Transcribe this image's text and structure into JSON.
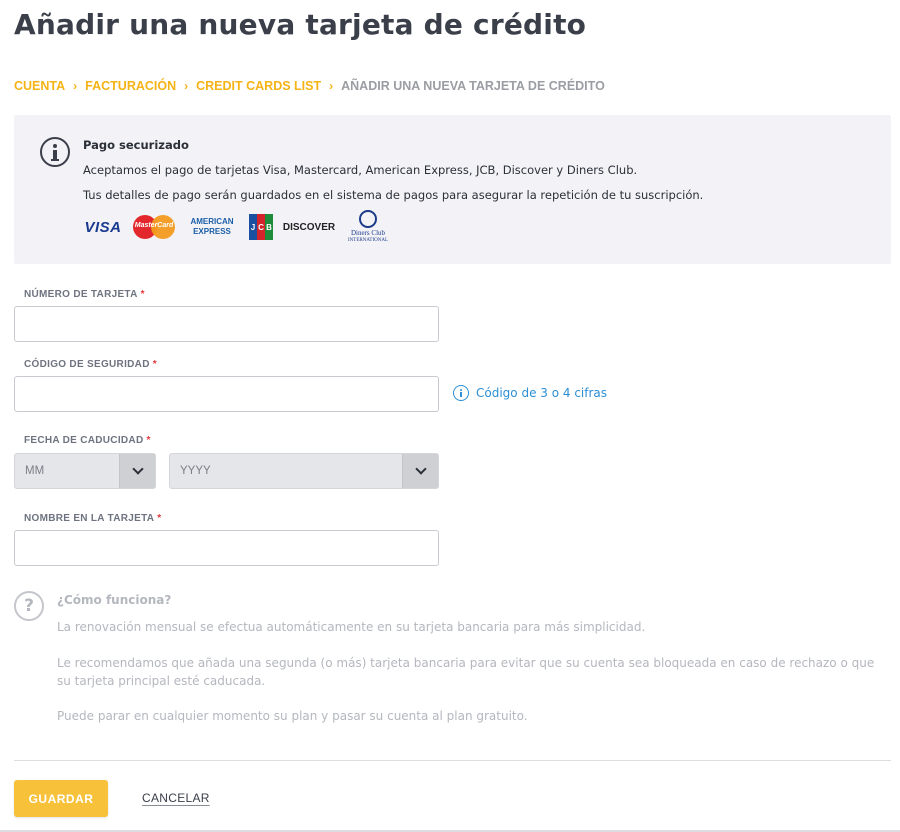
{
  "page": {
    "title": "Añadir una nueva tarjeta de crédito"
  },
  "breadcrumb": {
    "items": [
      "CUENTA",
      "FACTURACIÓN",
      "CREDIT CARDS LIST",
      "AÑADIR UNA NUEVA TARJETA DE CRÉDITO"
    ],
    "separator": "›"
  },
  "info": {
    "icon": "info-circle-icon",
    "title": "Pago securizado",
    "line1": "Aceptamos el pago de tarjetas Visa, Mastercard, American Express, JCB, Discover y Diners Club.",
    "line2": "Tus detalles de pago serán guardados en el sistema de pagos para asegurar la repetición de tu suscripción.",
    "logos": {
      "visa": "VISA",
      "mastercard": "MasterCard",
      "amex_1": "AMERICAN",
      "amex_2": "EXPRESS",
      "jcb": [
        "J",
        "C",
        "B"
      ],
      "discover": "DISCOVER",
      "diners_1": "Diners Club",
      "diners_2": "INTERNATIONAL"
    }
  },
  "form": {
    "required_mark": "*",
    "card_number": {
      "label": "NÚMERO DE TARJETA",
      "value": ""
    },
    "security_code": {
      "label": "CÓDIGO DE SEGURIDAD",
      "value": "",
      "hint": "Código de 3 o 4 cifras"
    },
    "expiry": {
      "label": "FECHA DE CADUCIDAD",
      "month": "MM",
      "year": "YYYY"
    },
    "card_name": {
      "label": "NOMBRE EN LA TARJETA",
      "value": ""
    }
  },
  "howto": {
    "icon_glyph": "?",
    "title": "¿Cómo funciona?",
    "p1": "La renovación mensual se efectua automáticamente en su tarjeta bancaria para más simplicidad.",
    "p2": "Le recomendamos que añada una segunda (o más) tarjeta bancaria para evitar que su cuenta sea bloqueada en caso de rechazo o que su tarjeta principal esté caducada.",
    "p3": "Puede parar en cualquier momento su plan y pasar su cuenta al plan gratuito."
  },
  "actions": {
    "save": "GUARDAR",
    "cancel": "CANCELAR"
  },
  "colors": {
    "accent": "#f5b316",
    "button": "#f7c23a",
    "link": "#2d8fd5",
    "required": "#e0393e"
  }
}
